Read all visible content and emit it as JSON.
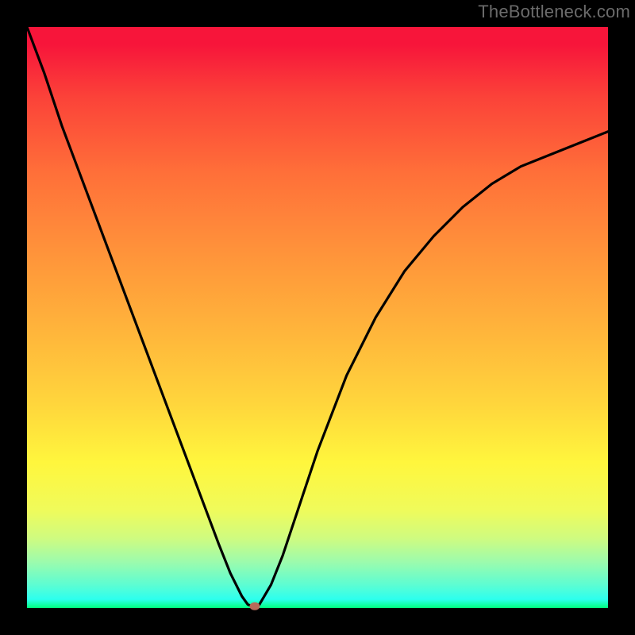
{
  "watermark": "TheBottleneck.com",
  "colors": {
    "gradient_top": "#f7153a",
    "gradient_mid": "#fff63d",
    "gradient_bottom": "#00ff7d",
    "curve": "#000000",
    "marker": "#b86a5a",
    "frame": "#000000"
  },
  "chart_data": {
    "type": "line",
    "title": "",
    "xlabel": "",
    "ylabel": "",
    "xlim": [
      0,
      100
    ],
    "ylim": [
      0,
      100
    ],
    "grid": false,
    "series": [
      {
        "name": "curve",
        "x": [
          0,
          3,
          6,
          9,
          12,
          15,
          18,
          21,
          24,
          27,
          30,
          33,
          35,
          37,
          38,
          39,
          40,
          42,
          44,
          47,
          50,
          55,
          60,
          65,
          70,
          75,
          80,
          85,
          90,
          95,
          100
        ],
        "y": [
          100,
          92,
          83,
          75,
          67,
          59,
          51,
          43,
          35,
          27,
          19,
          11,
          6,
          2,
          0.6,
          0.2,
          0.6,
          4,
          9,
          18,
          27,
          40,
          50,
          58,
          64,
          69,
          73,
          76,
          78,
          80,
          82
        ]
      }
    ],
    "marker": {
      "x": 39.2,
      "y": 0.3
    }
  }
}
